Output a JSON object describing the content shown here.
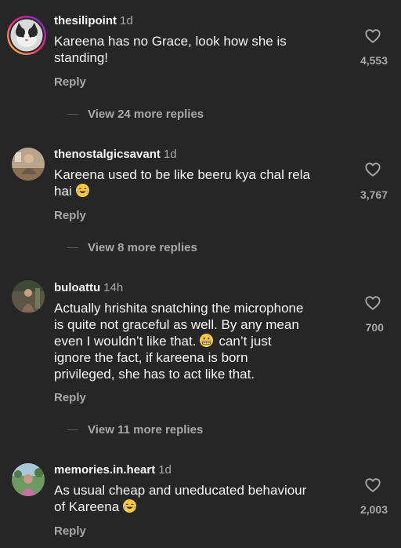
{
  "comments": [
    {
      "username": "thesilipoint",
      "time": "1d",
      "text": "Kareena has no Grace, look how she is standing!",
      "emoji": "",
      "likes": "4,553",
      "reply_label": "Reply",
      "view_replies": "View 24 more replies"
    },
    {
      "username": "thenostalgicsavant",
      "time": "1d",
      "text_1": "Kareena used to be like beeru kya chal rela",
      "text_2": "hai",
      "emoji": "laughing-tears",
      "likes": "3,767",
      "reply_label": "Reply",
      "view_replies": "View 8 more replies"
    },
    {
      "username": "buloattu",
      "time": "14h",
      "text_1": "Actually hrishita snatching the microphone",
      "text_2": "is quite not graceful as well. By any mean",
      "text_3a": "even I wouldn’t like that.",
      "text_3b": "can’t just",
      "text_4": "ignore the fact, if kareena is born",
      "text_5": "privileged, she has to act like that.",
      "emoji": "grimacing-face",
      "likes": "700",
      "reply_label": "Reply",
      "view_replies": "View 11 more replies"
    },
    {
      "username": "memories.in.heart",
      "time": "1d",
      "text_1": "As usual cheap and uneducated behaviour",
      "text_2": "of Kareena",
      "emoji": "laughing-tears",
      "likes": "2,003",
      "reply_label": "Reply"
    }
  ],
  "colors": {
    "background": "#262626",
    "primary_text": "#f5f5f5",
    "secondary_text": "#a8a8a8"
  }
}
